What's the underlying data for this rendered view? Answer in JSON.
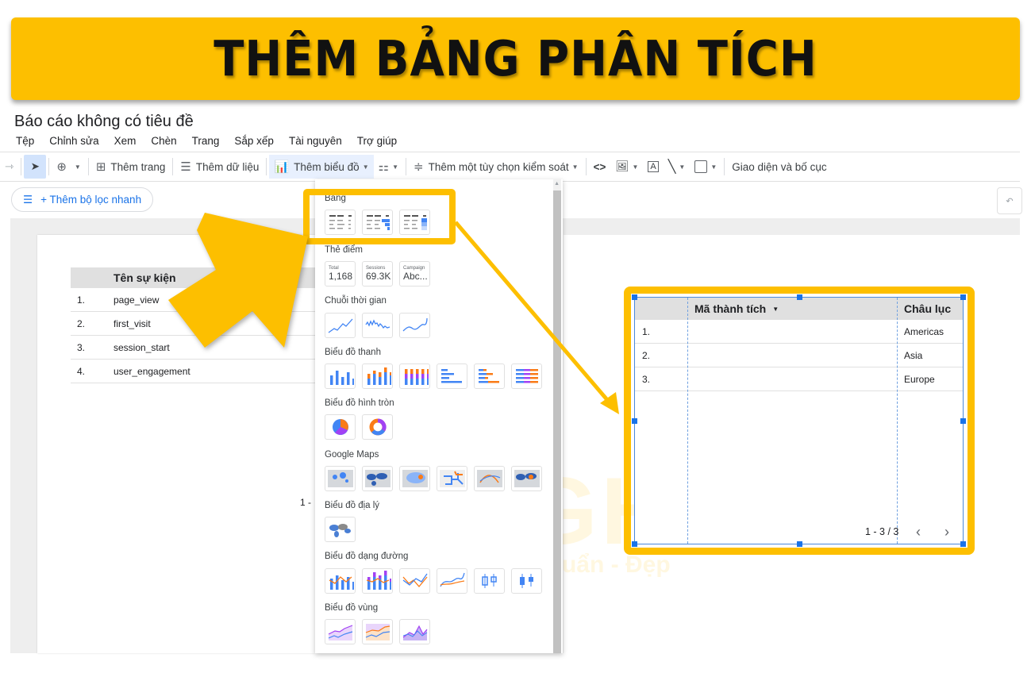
{
  "banner": {
    "title": "THÊM BẢNG PHÂN TÍCH"
  },
  "app": {
    "doc_title": "Báo cáo không có tiêu đề",
    "menu": [
      "Tệp",
      "Chỉnh sửa",
      "Xem",
      "Chèn",
      "Trang",
      "Sắp xếp",
      "Tài nguyên",
      "Trợ giúp"
    ],
    "toolbar": {
      "add_page": "Thêm trang",
      "add_data": "Thêm dữ liệu",
      "add_chart": "Thêm biểu đồ",
      "add_control": "Thêm một tùy chọn kiểm soát",
      "theme_layout": "Giao diện và bố cục"
    },
    "filter_button": "+ Thêm bộ lọc nhanh"
  },
  "left_table": {
    "header": "Tên sự kiện",
    "rows": [
      {
        "idx": "1.",
        "name": "page_view"
      },
      {
        "idx": "2.",
        "name": "first_visit"
      },
      {
        "idx": "3.",
        "name": "session_start"
      },
      {
        "idx": "4.",
        "name": "user_engagement"
      }
    ],
    "pager": "1 -"
  },
  "chart_menu": {
    "sections": {
      "table": "Bảng",
      "scorecard": "Thẻ điểm",
      "timeseries": "Chuỗi thời gian",
      "bar": "Biểu đồ thanh",
      "pie": "Biểu đồ hình tròn",
      "maps": "Google Maps",
      "geo": "Biểu đồ địa lý",
      "line": "Biểu đồ dạng đường",
      "area": "Biểu đồ vùng"
    },
    "scorecards": [
      {
        "label": "Total",
        "value": "1,168"
      },
      {
        "label": "Sessions",
        "value": "69.3K"
      },
      {
        "label": "Campaign",
        "value": "Abc..."
      }
    ]
  },
  "result_table": {
    "headers": [
      "Mã thành tích",
      "Châu lục"
    ],
    "rows": [
      {
        "idx": "1.",
        "code": "",
        "continent": "Americas"
      },
      {
        "idx": "2.",
        "code": "",
        "continent": "Asia"
      },
      {
        "idx": "3.",
        "code": "",
        "continent": "Europe"
      }
    ],
    "pager": "1 - 3 / 3"
  },
  "watermark": {
    "brand": "LIGHT",
    "slogan": "Nhanh - Chuẩn - Đẹp"
  }
}
